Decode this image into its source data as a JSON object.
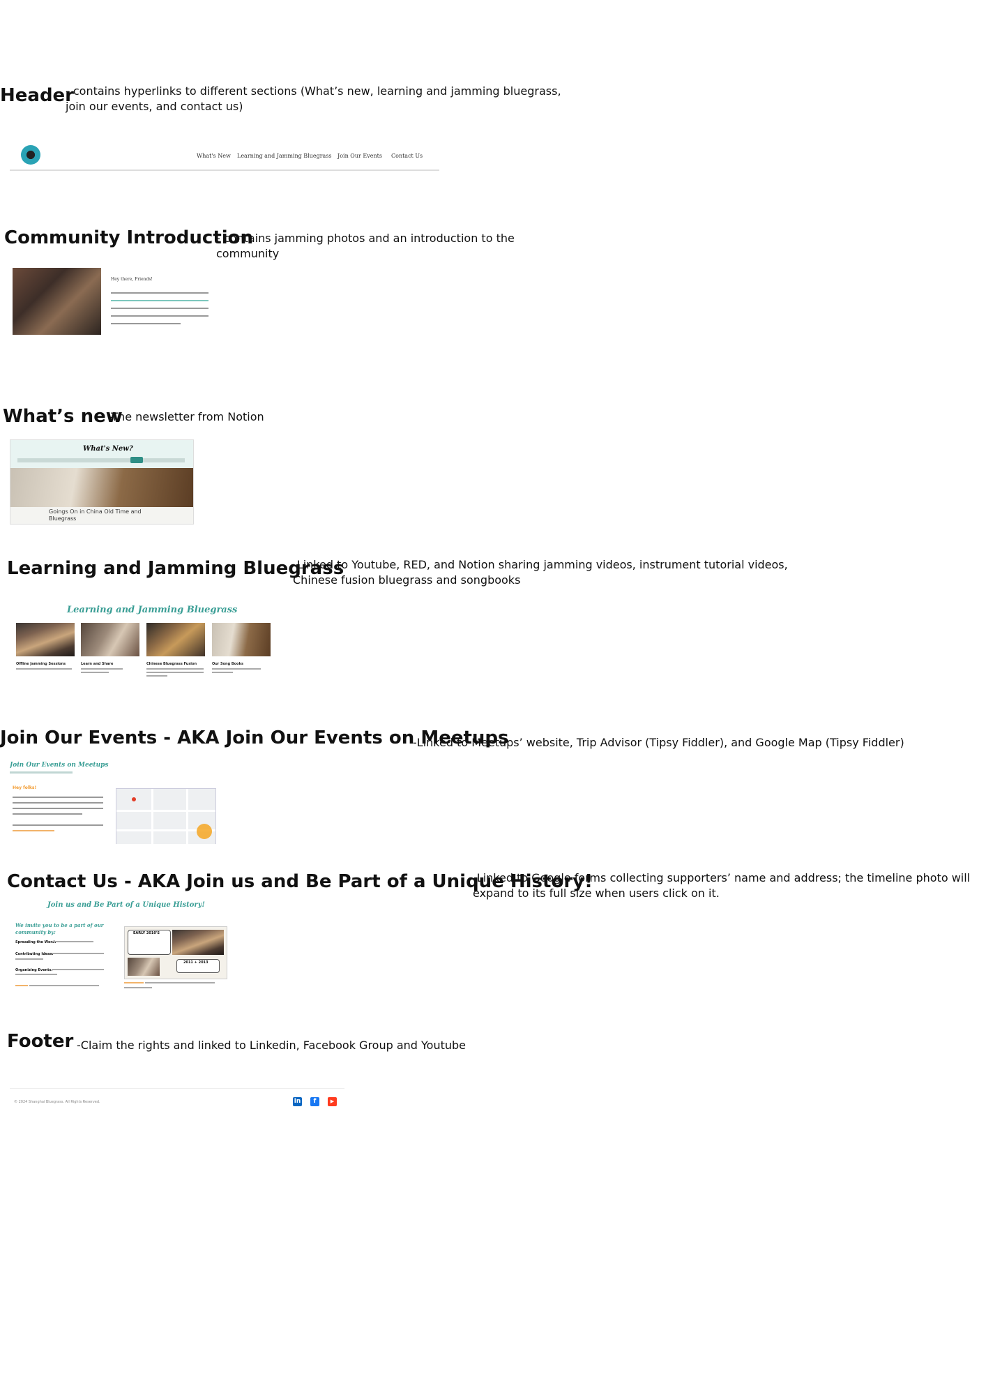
{
  "sections": {
    "header": {
      "title": "Header",
      "desc": "- contains hyperlinks to different sections (What’s new, learning and jamming bluegrass, join our events, and contact us)",
      "nav": [
        "What's New",
        "Learning and Jamming Bluegrass",
        "Join Our Events",
        "Contact Us"
      ]
    },
    "community": {
      "title": "Community Introduction",
      "desc": "- contains jamming photos and an introduction to the community",
      "greeting": "Hey there, Friends!"
    },
    "whats_new": {
      "title": "What’s new",
      "desc": "-The newsletter from Notion",
      "thumb_heading": "What's New?",
      "thumb_caption": "Goings On in China Old Time and Bluegrass"
    },
    "learning": {
      "title": "Learning and Jamming Bluegrass",
      "desc": "-Linked to Youtube, RED, and Notion sharing jamming videos, instrument tutorial videos, Chinese fusion bluegrass and songbooks",
      "thumb_heading": "Learning and Jamming Bluegrass",
      "cards": [
        "Offline Jamming Sessions",
        "Learn and Share",
        "Chinese Bluegrass Fusion",
        "Our Song Books"
      ]
    },
    "events": {
      "title": "Join Our Events - AKA Join Our Events on Meetups",
      "desc": "-Linked to Meetups’ website, Trip Advisor (Tipsy Fiddler), and Google Map (Tipsy Fiddler)",
      "thumb_heading": "Join Our Events on Meetups",
      "thumb_sub": "Hey folks!"
    },
    "contact": {
      "title": "Contact Us - AKA Join us and Be Part of a Unique History!",
      "desc": "-Linked to Google forms collecting supporters’ name and address; the timeline photo will expand to its full size when users click on it.",
      "thumb_heading": "Join us and Be Part of a Unique History!",
      "thumb_sub": "We invite you to be a part of our community by:",
      "bullets": [
        "Spreading the Word:",
        "Contributing Ideas:",
        "Organizing Events:"
      ],
      "timeline_labels": [
        "EARLY 2010'S",
        "2011 + 2013"
      ]
    },
    "footer": {
      "title": "Footer",
      "desc": "-Claim the rights and linked to Linkedin, Facebook Group and Youtube",
      "copyright": "© 2024 Shanghai Bluegrass. All Rights Reserved.",
      "icons": [
        "in",
        "f",
        "▶"
      ]
    }
  },
  "colors": {
    "teal": "#3a9e95",
    "orange": "#f29a2e",
    "linkedin": "#0a66c2",
    "facebook": "#1877f2",
    "youtube": "#ff3b1f"
  }
}
